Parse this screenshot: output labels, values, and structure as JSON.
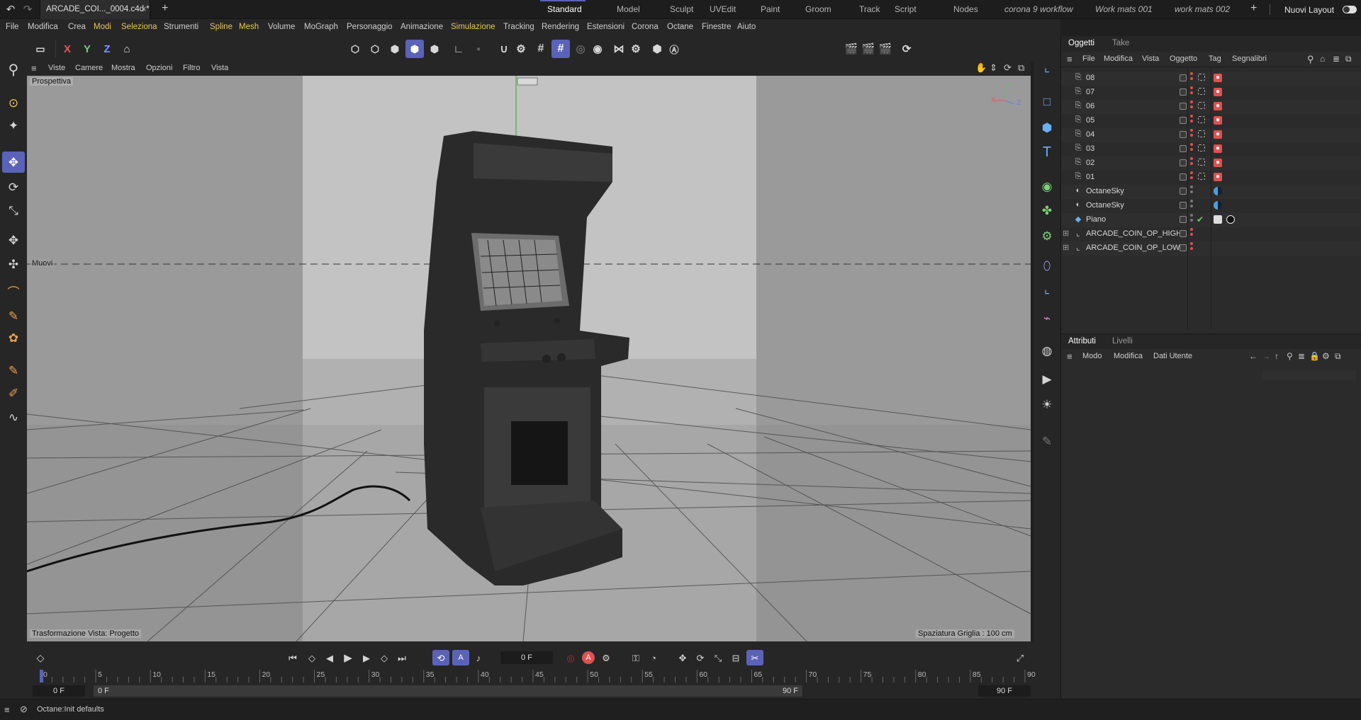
{
  "app": {
    "doc_tab": "ARCADE_COI..._0004.c4d *",
    "add_tab": "+",
    "layouts": [
      {
        "label": "Standard",
        "active": true,
        "italic": false
      },
      {
        "label": "Model",
        "active": false,
        "italic": false
      },
      {
        "label": "Sculpt",
        "active": false,
        "italic": false
      },
      {
        "label": "UVEdit",
        "active": false,
        "italic": false
      },
      {
        "label": "Paint",
        "active": false,
        "italic": false
      },
      {
        "label": "Groom",
        "active": false,
        "italic": false
      },
      {
        "label": "Track",
        "active": false,
        "italic": false
      },
      {
        "label": "Script",
        "active": false,
        "italic": false
      },
      {
        "label": "Nodes",
        "active": false,
        "italic": false
      },
      {
        "label": "corona 9 workflow",
        "active": false,
        "italic": true
      },
      {
        "label": "Work mats 001",
        "active": false,
        "italic": true
      },
      {
        "label": "work mats 002",
        "active": false,
        "italic": true
      }
    ],
    "new_layout": "Nuovi Layout"
  },
  "menu": [
    {
      "label": "File",
      "hl": false
    },
    {
      "label": "Modifica",
      "hl": false
    },
    {
      "label": "Crea",
      "hl": false
    },
    {
      "label": "Modi",
      "hl": true
    },
    {
      "label": "Seleziona",
      "hl": true
    },
    {
      "label": "Strumenti",
      "hl": false
    },
    {
      "label": "Spline",
      "hl": true
    },
    {
      "label": "Mesh",
      "hl": true
    },
    {
      "label": "Volume",
      "hl": false
    },
    {
      "label": "MoGraph",
      "hl": false
    },
    {
      "label": "Personaggio",
      "hl": false
    },
    {
      "label": "Animazione",
      "hl": false
    },
    {
      "label": "Simulazione",
      "hl": true
    },
    {
      "label": "Tracking",
      "hl": false
    },
    {
      "label": "Rendering",
      "hl": false
    },
    {
      "label": "Estensioni",
      "hl": false
    },
    {
      "label": "Corona",
      "hl": false
    },
    {
      "label": "Octane",
      "hl": false
    },
    {
      "label": "Finestre",
      "hl": false
    },
    {
      "label": "Aiuto",
      "hl": false
    }
  ],
  "axis_buttons": [
    "X",
    "Y",
    "Z"
  ],
  "viewport": {
    "menu": [
      "Viste",
      "Camere",
      "Mostra",
      "Opzioni",
      "Filtro",
      "Vista"
    ],
    "camera_label": "Prospettiva",
    "guide_label": "Muovi",
    "bottom_left": "Trasformazione Vista: Progetto",
    "bottom_right": "Spaziatura Griglia : 100 cm",
    "axis_x": "X",
    "axis_y": "Y",
    "axis_z": "Z"
  },
  "objects_panel": {
    "tabs": [
      {
        "label": "Oggetti",
        "active": true
      },
      {
        "label": "Take",
        "active": false
      }
    ],
    "menu": [
      "File",
      "Modifica",
      "Vista",
      "Oggetto",
      "Tag",
      "Segnalibri"
    ],
    "items": [
      {
        "name": "08",
        "kind": "camera",
        "tag": "camera-tag"
      },
      {
        "name": "07",
        "kind": "camera",
        "tag": "camera-tag"
      },
      {
        "name": "06",
        "kind": "camera",
        "tag": "camera-tag"
      },
      {
        "name": "05",
        "kind": "camera",
        "tag": "camera-tag"
      },
      {
        "name": "04",
        "kind": "camera",
        "tag": "camera-tag"
      },
      {
        "name": "03",
        "kind": "camera",
        "tag": "camera-tag"
      },
      {
        "name": "02",
        "kind": "camera",
        "tag": "camera-tag"
      },
      {
        "name": "01",
        "kind": "camera",
        "tag": "camera-tag"
      },
      {
        "name": "OctaneSky",
        "kind": "sky",
        "tag": "sky-tag"
      },
      {
        "name": "OctaneSky",
        "kind": "sky",
        "tag": "sky-tag"
      },
      {
        "name": "Piano",
        "kind": "plane",
        "tag": "material-tag"
      },
      {
        "name": "ARCADE_COIN_OP_HIGH",
        "kind": "null",
        "tag": ""
      },
      {
        "name": "ARCADE_COIN_OP_LOW",
        "kind": "null",
        "tag": ""
      }
    ]
  },
  "attributes_panel": {
    "tabs": [
      {
        "label": "Attributi",
        "active": true
      },
      {
        "label": "Livelli",
        "active": false
      }
    ],
    "menu": [
      "Modo",
      "Modifica",
      "Dati Utente"
    ]
  },
  "timeline": {
    "current_frame": "0 F",
    "ticks": [
      "0",
      "5",
      "10",
      "15",
      "20",
      "25",
      "30",
      "35",
      "40",
      "45",
      "50",
      "55",
      "60",
      "65",
      "70",
      "75",
      "80",
      "85",
      "90"
    ],
    "range_start": "0 F",
    "range_inner_start": "0 F",
    "range_inner_end": "90 F",
    "range_end": "90 F",
    "record_label": "A"
  },
  "status": {
    "text": "Octane:Init defaults"
  },
  "colors": {
    "accent": "#5a63b8",
    "highlight_menu": "#e8c95a",
    "record": "#e05050"
  }
}
